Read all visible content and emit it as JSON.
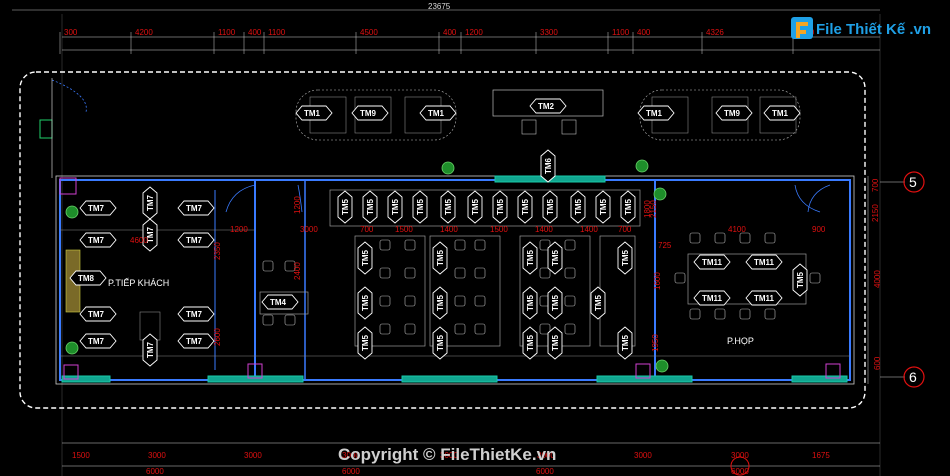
{
  "title_dim": "23675",
  "top_dims": [
    "300",
    "4200",
    "1100",
    "400",
    "1100",
    "4500",
    "400",
    "1200",
    "3300",
    "1100",
    "400",
    "4326",
    "1100"
  ],
  "bottom_dims": [
    "1500",
    "3000",
    "3000",
    "3000",
    "3000",
    "3000",
    "3000",
    "3000",
    "1675"
  ],
  "bottom_dims2": [
    "6000",
    "6000",
    "6000",
    "6000"
  ],
  "interior_dims": [
    "4600",
    "1200",
    "3000",
    "700",
    "1500",
    "1400",
    "1500",
    "1400",
    "1400",
    "700",
    "725",
    "4100",
    "900",
    "2350",
    "2600",
    "1200",
    "1800",
    "2400",
    "1600",
    "2150",
    "1950"
  ],
  "right_dims": [
    "700",
    "2150",
    "4000",
    "600"
  ],
  "axis_labels": [
    "5",
    "6"
  ],
  "room_labels": {
    "reception": "P.TIẾP KHÁCH",
    "meeting": "P.HỌP"
  },
  "tags": {
    "tm1": "TM1",
    "tm2": "TM2",
    "tm4": "TM4",
    "tm5": "TM5",
    "tm6": "TM6",
    "tm7": "TM7",
    "tm8": "TM8",
    "tm9": "TM9",
    "tm11": "TM11"
  },
  "logo": {
    "text": "File Thiết Kế .vn"
  },
  "copyright": "Copyright © FileThietKe.vn",
  "colors": {
    "wall": "#3a7bff",
    "outline": "#ffffff",
    "dim": "#e01010",
    "glass": "#19c9a8",
    "logo": "#1fa0e6"
  }
}
